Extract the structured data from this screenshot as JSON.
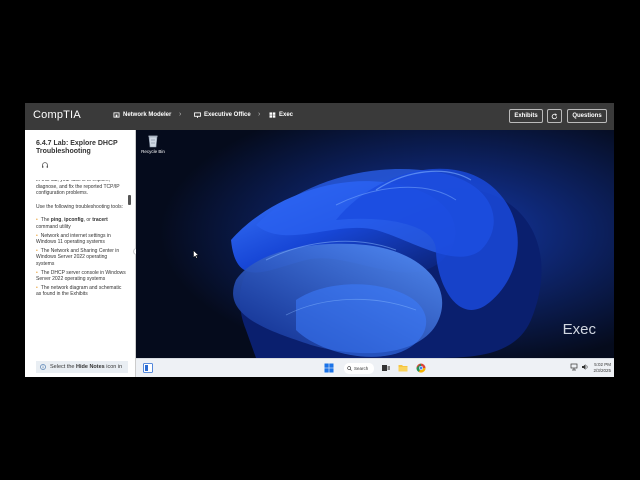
{
  "header": {
    "logo": "CompTIA",
    "breadcrumb": [
      "Network Modeler",
      "Executive Office",
      "Exec"
    ],
    "exhibits_label": "Exhibits",
    "questions_label": "Questions"
  },
  "sidebar": {
    "title": "6.4.7 Lab: Explore DHCP Troubleshooting",
    "partial_text": "In this lab, your task is to explore, diagnose, and fix the reported TCP/IP configuration problems.",
    "intro": "Use the following troubleshooting tools:",
    "tools": [
      {
        "pre": "The ",
        "bold": "ping",
        "mid": ", ",
        "bold2": "ipconfig",
        "mid2": ", or ",
        "bold3": "tracert",
        "post": " command utility"
      },
      {
        "text": "Network and internet settings in Windows 11 operating systems"
      },
      {
        "text": "The Network and Sharing Center in Windows Server 2022 operating systems"
      },
      {
        "text": "The DHCP server console in Windows Server 2022 operating systems"
      },
      {
        "text": "The network diagram and schematic as found in the Exhibits"
      }
    ],
    "note_pre": "Select the ",
    "note_bold": "Hide Notes",
    "note_post": " icon in"
  },
  "desktop": {
    "recycle_bin_label": "Recycle Bin",
    "watermark": "Exec"
  },
  "taskbar": {
    "search_label": "Search",
    "time": "5:02 PM",
    "date": "2/3/2025"
  },
  "colors": {
    "topbar": "#3a3a3a",
    "accent_bullet": "#e8a23a",
    "wallpaper_dark": "#050b1c",
    "wallpaper_blue": "#1f5bff"
  }
}
